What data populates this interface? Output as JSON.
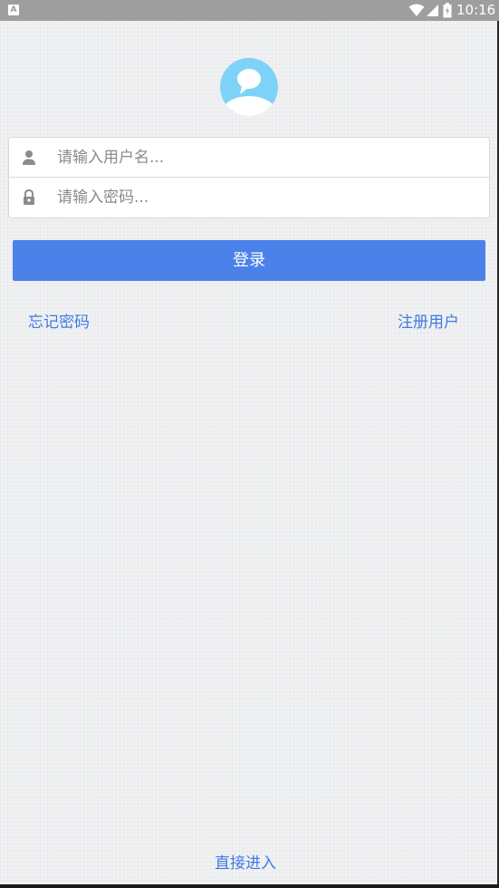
{
  "status_bar": {
    "notification_icon": "A",
    "time": "10:16",
    "icons": [
      "wifi-icon",
      "signal-icon",
      "battery-icon"
    ]
  },
  "avatar": {
    "icon": "user-chat-avatar-icon",
    "color": "#7dd3f7"
  },
  "form": {
    "username": {
      "icon": "user-icon",
      "placeholder": "请输入用户名...",
      "value": ""
    },
    "password": {
      "icon": "lock-icon",
      "placeholder": "请输入密码...",
      "value": ""
    }
  },
  "login_button": {
    "label": "登录",
    "color": "#4a82ea"
  },
  "links": {
    "forgot_password": "忘记密码",
    "register": "注册用户",
    "direct_enter": "直接进入"
  },
  "colors": {
    "link": "#3f7be6",
    "background": "#f1f2f3",
    "status_bar": "#9e9e9e"
  }
}
